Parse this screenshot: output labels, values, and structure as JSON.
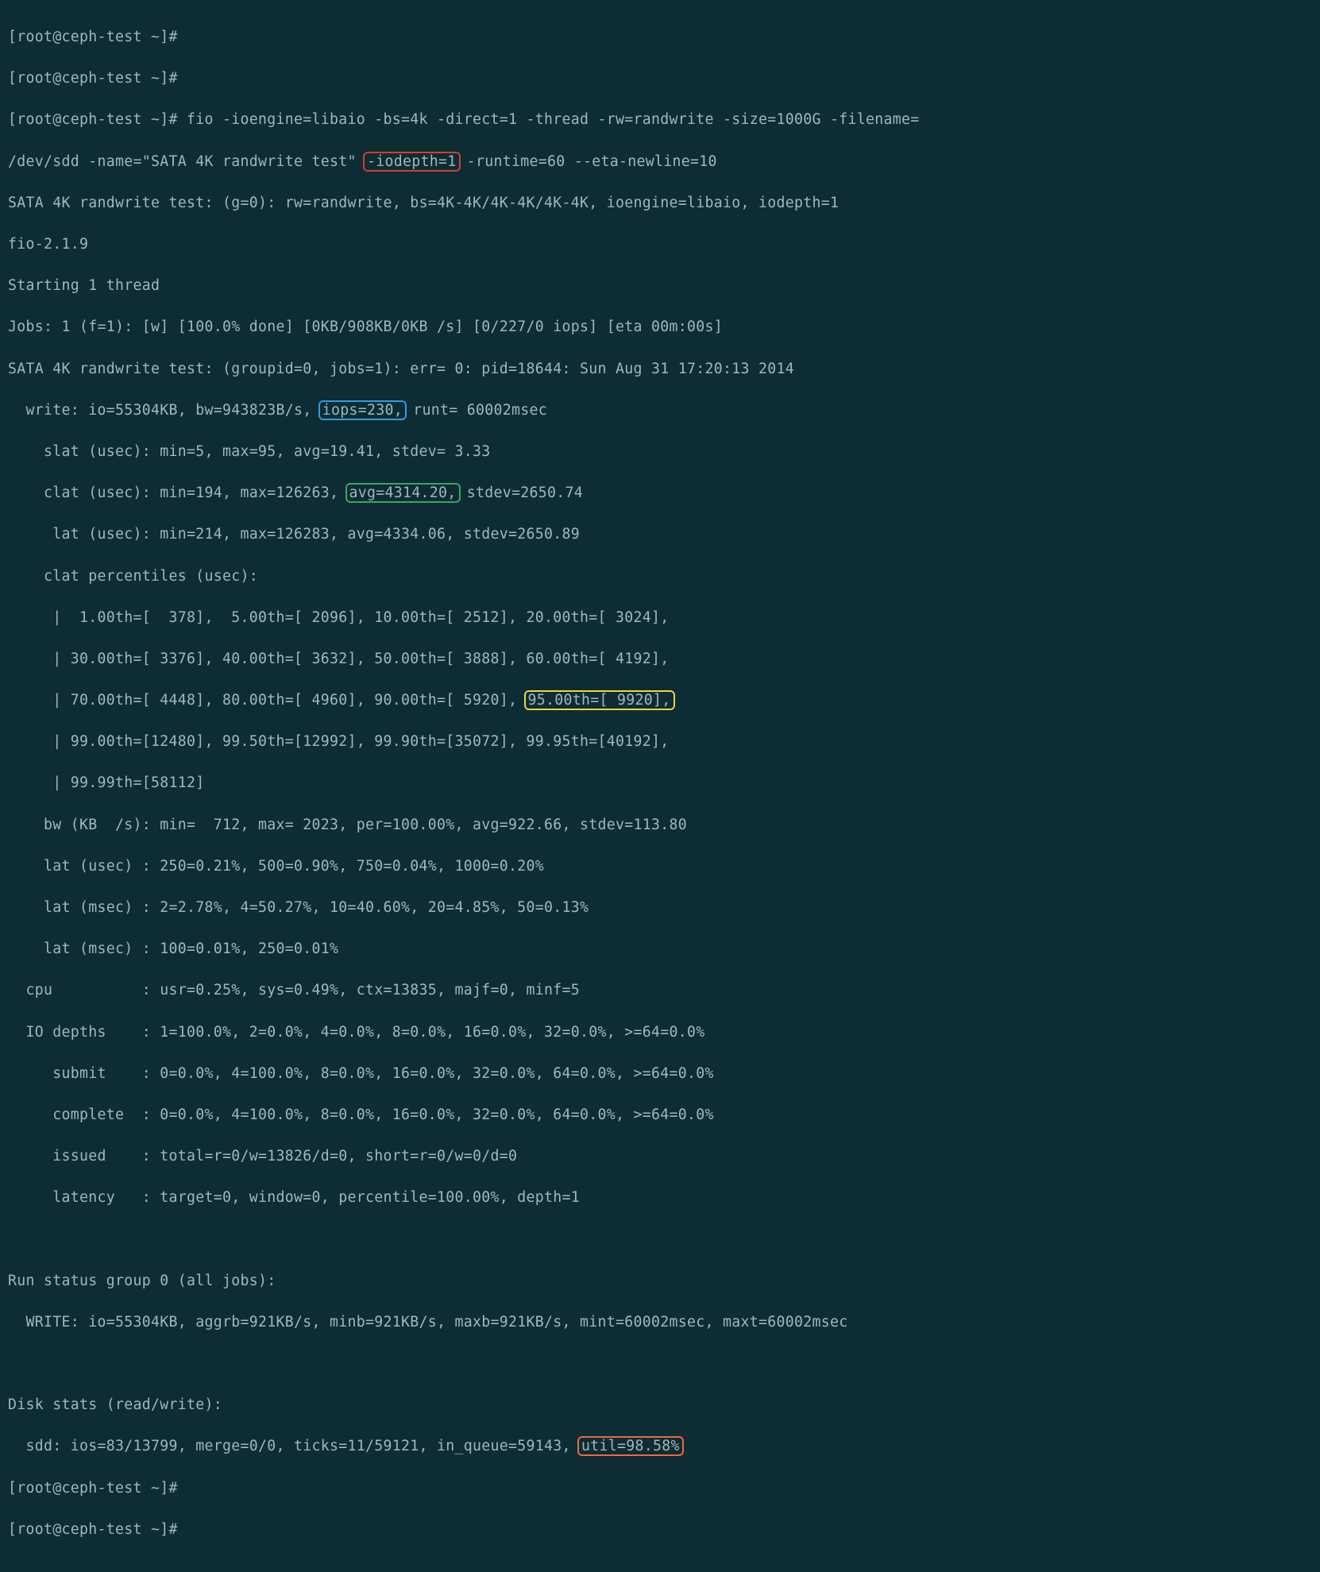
{
  "prompt1": "[root@ceph-test ~]#",
  "prompt2": "[root@ceph-test ~]#",
  "cmd_prompt": "[root@ceph-test ~]# ",
  "cmd_part1": "fio -ioengine=libaio -bs=4k -direct=1 -thread -rw=randwrite -size=1000G -filename=",
  "cmd_part2": "/dev/sdd -name=\"SATA 4K randwrite test\" ",
  "cmd_iodepth": "-iodepth=1",
  "cmd_part3": " -runtime=60 --eta-newline=10",
  "out_jobdef": "SATA 4K randwrite test: (g=0): rw=randwrite, bs=4K-4K/4K-4K/4K-4K, ioengine=libaio, iodepth=1",
  "out_ver": "fio-2.1.9",
  "out_start": "Starting 1 thread",
  "out_jobs": "Jobs: 1 (f=1): [w] [100.0% done] [0KB/908KB/0KB /s] [0/227/0 iops] [eta 00m:00s]",
  "out_hdr": "SATA 4K randwrite test: (groupid=0, jobs=1): err= 0: pid=18644: Sun Aug 31 17:20:13 2014",
  "write_pre": "  write: io=55304KB, bw=943823B/s, ",
  "write_iops": "iops=230,",
  "write_post": " runt= 60002msec",
  "slat": "    slat (usec): min=5, max=95, avg=19.41, stdev= 3.33",
  "clat_pre": "    clat (usec): min=194, max=126263, ",
  "clat_avg": "avg=4314.20,",
  "clat_post": " stdev=2650.74",
  "lat": "     lat (usec): min=214, max=126283, avg=4334.06, stdev=2650.89",
  "pct_hdr": "    clat percentiles (usec):",
  "pct1": "     |  1.00th=[  378],  5.00th=[ 2096], 10.00th=[ 2512], 20.00th=[ 3024],",
  "pct2": "     | 30.00th=[ 3376], 40.00th=[ 3632], 50.00th=[ 3888], 60.00th=[ 4192],",
  "pct3_pre": "     | 70.00th=[ 4448], 80.00th=[ 4960], 90.00th=[ 5920], ",
  "pct3_hl": "95.00th=[ 9920],",
  "pct4": "     | 99.00th=[12480], 99.50th=[12992], 99.90th=[35072], 99.95th=[40192],",
  "pct5": "     | 99.99th=[58112]",
  "bw": "    bw (KB  /s): min=  712, max= 2023, per=100.00%, avg=922.66, stdev=113.80",
  "lat_u": "    lat (usec) : 250=0.21%, 500=0.90%, 750=0.04%, 1000=0.20%",
  "lat_m1": "    lat (msec) : 2=2.78%, 4=50.27%, 10=40.60%, 20=4.85%, 50=0.13%",
  "lat_m2": "    lat (msec) : 100=0.01%, 250=0.01%",
  "cpu": "  cpu          : usr=0.25%, sys=0.49%, ctx=13835, majf=0, minf=5",
  "iod": "  IO depths    : 1=100.0%, 2=0.0%, 4=0.0%, 8=0.0%, 16=0.0%, 32=0.0%, >=64=0.0%",
  "sub": "     submit    : 0=0.0%, 4=100.0%, 8=0.0%, 16=0.0%, 32=0.0%, 64=0.0%, >=64=0.0%",
  "comp": "     complete  : 0=0.0%, 4=100.0%, 8=0.0%, 16=0.0%, 32=0.0%, 64=0.0%, >=64=0.0%",
  "iss": "     issued    : total=r=0/w=13826/d=0, short=r=0/w=0/d=0",
  "lat2": "     latency   : target=0, window=0, percentile=100.00%, depth=1",
  "blank": " ",
  "rsg": "Run status group 0 (all jobs):",
  "rsg_w": "  WRITE: io=55304KB, aggrb=921KB/s, minb=921KB/s, maxb=921KB/s, mint=60002msec, maxt=60002msec",
  "ds_hdr": "Disk stats (read/write):",
  "ds_pre": "  sdd: ios=83/13799, merge=0/0, ticks=11/59121, in_queue=59143, ",
  "ds_util": "util=98.58%",
  "prompt_end1": "[root@ceph-test ~]#",
  "prompt_end2": "[root@ceph-test ~]#",
  "highlight_colors": {
    "iodepth": "#d63c2b",
    "iops": "#2a9ee6",
    "clat_avg": "#2fae52",
    "p95": "#f4d23c",
    "util": "#ee6a3a"
  }
}
